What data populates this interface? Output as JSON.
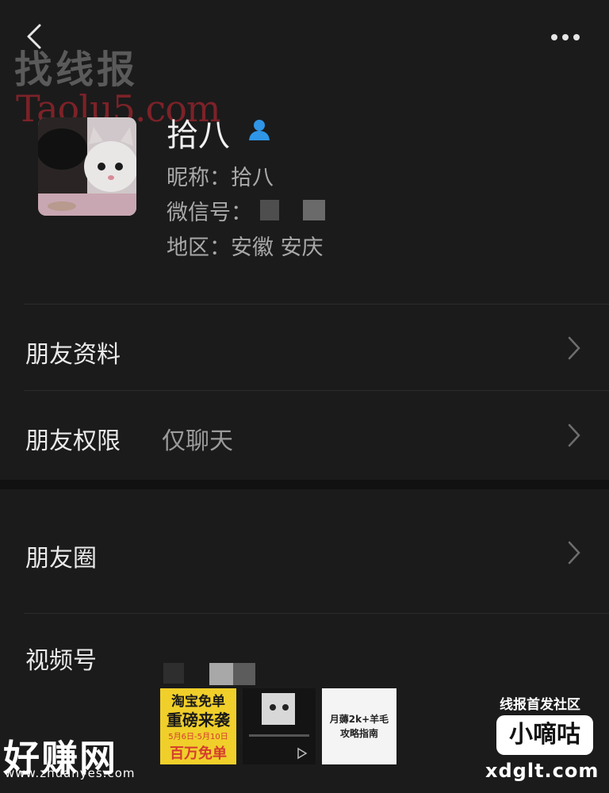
{
  "header": {
    "back_icon": "chevron-left-icon",
    "more_icon": "more-dots-icon"
  },
  "watermarks": {
    "top_cn": "找线报",
    "top_en": "Taolu5.com",
    "bottom_left": "好赚网",
    "bottom_left_url": "www.zhuanyes.com",
    "bottom_right_top": "线报首发社区",
    "bottom_right_badge": "小嘀咕",
    "bottom_right_url": "xdglt.com"
  },
  "profile": {
    "name": "拾八",
    "nickname": "昵称：拾八",
    "wechat_id": "微信号：",
    "region": "地区：安徽 安庆"
  },
  "rows": {
    "friend_info": "朋友资料",
    "friend_permission": "朋友权限",
    "friend_permission_value": "仅聊天",
    "moments": "朋友圈",
    "channels": "视频号"
  },
  "ads": {
    "ad1_line1": "淘宝免单",
    "ad1_line2": "重磅来袭",
    "ad1_line3": "5月6日-5月10日",
    "ad1_line4": "百万免单",
    "ad3_line1": "月薅2k+羊毛",
    "ad3_line2": "攻略指南"
  },
  "colors": {
    "background": "#1b1b1b",
    "verify_icon": "#2f95e6",
    "watermark_red": "#7c2228"
  }
}
